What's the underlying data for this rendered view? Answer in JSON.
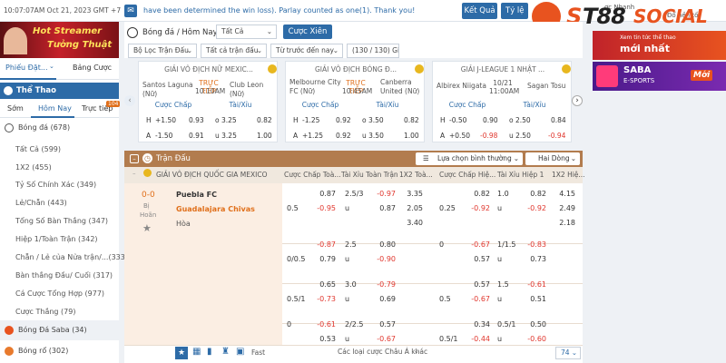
{
  "topbar": {
    "clock": "10:07:07AM Oct 21, 2023 GMT +7",
    "notice": "have been determined the win loss). Parlay counted as one(1). Thank you!",
    "results_button": "Kết Quả",
    "odds_button": "Tỷ lệ",
    "quick_bet_label": "ợc Nhanh",
    "bg_label": "Đổ nền tối"
  },
  "logo": {
    "text": "SOCIAL",
    "brand_color": "#e8531f"
  },
  "left_banner": {
    "line1": "Hot Streamer",
    "line2": "Tưởng Thuật"
  },
  "sidebar": {
    "tab_betslip": "Phiếu Đặt...",
    "tab_stats": "Bảng Cược",
    "sport_title": "Thể Thao",
    "sub_tabs": [
      "Sớm",
      "Hôm Nay",
      "Trực tiếp"
    ],
    "live_badge": "104",
    "football": "Bóng đá (678)",
    "items": [
      "Tất Cả (599)",
      "1X2 (455)",
      "Tỷ Số Chính Xác (349)",
      "Lẻ/Chẵn (443)",
      "Tổng Số Bàn Thắng (347)",
      "Hiệp 1/Toàn Trận (342)",
      "Chẵn / Lẻ của Nửa trận/...(333)",
      "Bàn thắng Đầu/ Cuối (317)",
      "Cá Cược Tổng Hợp (977)",
      "Cược Thắng (79)"
    ],
    "saba": "Bóng Đá Saba (34)",
    "basketball": "Bóng rổ (302)"
  },
  "filterbar": {
    "title": "Bóng đá / Hôm Nay",
    "all_select": "Tất Cả",
    "parlay_button": "Cược Xiên",
    "league_filter": "Bộ Lọc Trận Đấu",
    "all_matches": "Tất cả trận đấu",
    "sort": "Từ trước đến nay",
    "count": "(130 / 130) Giải"
  },
  "cards": [
    {
      "league": "GIẢI VÔ ĐỊCH NỮ MEXIC...",
      "home": "Santos Laguna (Nữ)",
      "away": "Club Leon (Nữ)",
      "status": "TRỰC TIẾP",
      "time": "10:10AM",
      "h_label": "H",
      "a_label": "A",
      "hdp": [
        "+1.50",
        "0.93",
        "-1.50",
        "0.91"
      ],
      "ou": [
        "3.25",
        "0.82",
        "3.25",
        "1.00"
      ]
    },
    {
      "league": "GIẢI VÔ ĐỊCH BÓNG Đ...",
      "home": "Melbourne City FC (Nữ)",
      "away": "Canberra United (Nữ)",
      "status": "TRỰC TIẾP",
      "time": "10:45AM",
      "h_label": "H",
      "a_label": "A",
      "hdp": [
        "-1.25",
        "0.92",
        "+1.25",
        "0.92"
      ],
      "ou": [
        "3.50",
        "0.82",
        "3.50",
        "1.00"
      ]
    },
    {
      "league": "GIẢI J-LEAGUE 1 NHẬT ...",
      "home": "Albirex Niigata",
      "away": "Sagan Tosu",
      "status": "10/21",
      "time": "11:00AM",
      "h_label": "H",
      "a_label": "A",
      "hdp": [
        "-0.50",
        "0.90",
        "+0.50",
        "-0.98"
      ],
      "ou": [
        "2.50",
        "0.84",
        "2.50",
        "-0.94"
      ]
    }
  ],
  "card_heads": {
    "hdp": "Cược Chấp",
    "ou": "Tài/Xỉu"
  },
  "match_table": {
    "section_title": "Trận Đấu",
    "market_select": "Lựa chọn bình thường",
    "lines_select": "Hai Dòng",
    "league": "GIẢI VÔ ĐỊCH QUỐC GIA MEXICO",
    "cols": [
      "Cược Chấp Toà...",
      "Tài Xỉu Toàn Trận",
      "1X2 Toà...",
      "Cược Chấp Hiệ...",
      "Tài Xỉu Hiệp 1",
      "1X2 Hiệ..."
    ],
    "score": "0-0",
    "status_line1": "Bị",
    "status_line2": "Hoãn",
    "home": "Puebla FC",
    "away": "Guadalajara Chivas",
    "draw": "Hòa",
    "more_link": "Các loại cược Châu Á khác",
    "fast_label": "Fast",
    "page_count": "74",
    "rows": [
      {
        "h1": [
          "",
          "0.87",
          "2.5/3",
          "-0.97",
          "3.35",
          "",
          "0.82",
          "1.0",
          "0.82",
          "4.15"
        ],
        "h2": [
          "0.5",
          "-0.95",
          "u",
          "0.87",
          "2.05",
          "0.25",
          "-0.92",
          "u",
          "-0.92",
          "2.49"
        ],
        "h3": [
          "",
          "",
          "",
          "",
          "3.40",
          "",
          "",
          "",
          "",
          "2.18"
        ]
      },
      {
        "h1": [
          "",
          "-0.87",
          "2.5",
          "0.80",
          "",
          "0",
          "-0.67",
          "1/1.5",
          "-0.83",
          ""
        ],
        "h2": [
          "0/0.5",
          "0.79",
          "u",
          "-0.90",
          "",
          "",
          "0.57",
          "u",
          "0.73",
          ""
        ]
      },
      {
        "h1": [
          "",
          "0.65",
          "3.0",
          "-0.79",
          "",
          "",
          "0.57",
          "1.5",
          "-0.61",
          ""
        ],
        "h2": [
          "0.5/1",
          "-0.73",
          "u",
          "0.69",
          "",
          "0.5",
          "-0.67",
          "u",
          "0.51",
          ""
        ]
      },
      {
        "h1": [
          "0",
          "-0.61",
          "2/2.5",
          "0.57",
          "",
          "",
          "0.34",
          "0.5/1",
          "0.50",
          ""
        ],
        "h2": [
          "",
          "0.53",
          "u",
          "-0.67",
          "",
          "0.5/1",
          "-0.44",
          "u",
          "-0.60",
          ""
        ]
      }
    ]
  },
  "right_banners": [
    {
      "line1": "Xem tin tức thể thao",
      "line2": "mới nhất"
    },
    {
      "line1": "SABA",
      "line2": "E-SPORTS",
      "tag": "Mới"
    }
  ]
}
